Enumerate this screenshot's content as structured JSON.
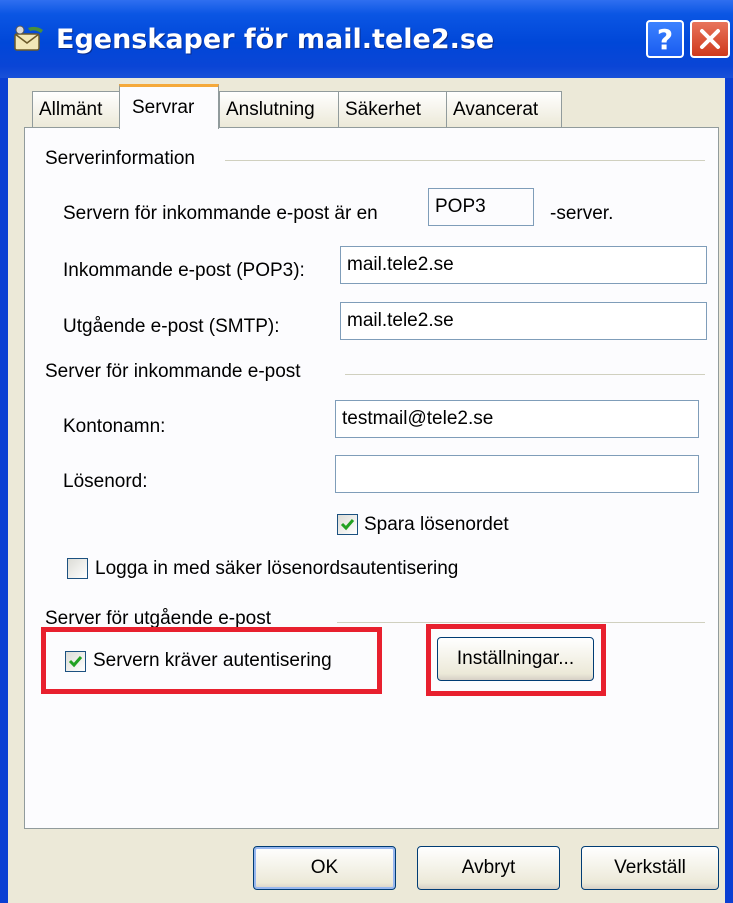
{
  "window": {
    "title": "Egenskaper för mail.tele2.se",
    "help_button": "?",
    "close_button": "✕"
  },
  "tabs": [
    {
      "label": "Allmänt"
    },
    {
      "label": "Servrar"
    },
    {
      "label": "Anslutning"
    },
    {
      "label": "Säkerhet"
    },
    {
      "label": "Avancerat"
    }
  ],
  "active_tab": "Servrar",
  "server_info": {
    "heading": "Serverinformation",
    "incoming_type_prefix": "Servern för inkommande e-post är en",
    "incoming_type_value": "POP3",
    "incoming_type_suffix": "-server.",
    "incoming_label": "Inkommande e-post (POP3):",
    "incoming_value": "mail.tele2.se",
    "outgoing_label": "Utgående e-post (SMTP):",
    "outgoing_value": "mail.tele2.se"
  },
  "incoming_server": {
    "heading": "Server för inkommande e-post",
    "account_label": "Kontonamn:",
    "account_value": "testmail@tele2.se",
    "password_label": "Lösenord:",
    "password_value": "",
    "save_password_label": "Spara lösenordet",
    "save_password_checked": true,
    "secure_login_label": "Logga in med säker lösenordsautentisering",
    "secure_login_checked": false
  },
  "outgoing_server": {
    "heading": "Server för utgående e-post",
    "requires_auth_label": "Servern kräver autentisering",
    "requires_auth_checked": true,
    "settings_button": "Inställningar..."
  },
  "footer": {
    "ok": "OK",
    "cancel": "Avbryt",
    "apply": "Verkställ"
  },
  "colors": {
    "titlebar": "#0a45d6",
    "dialog_bg": "#ece9d8",
    "highlight": "#e8202e",
    "check": "#21a121"
  }
}
